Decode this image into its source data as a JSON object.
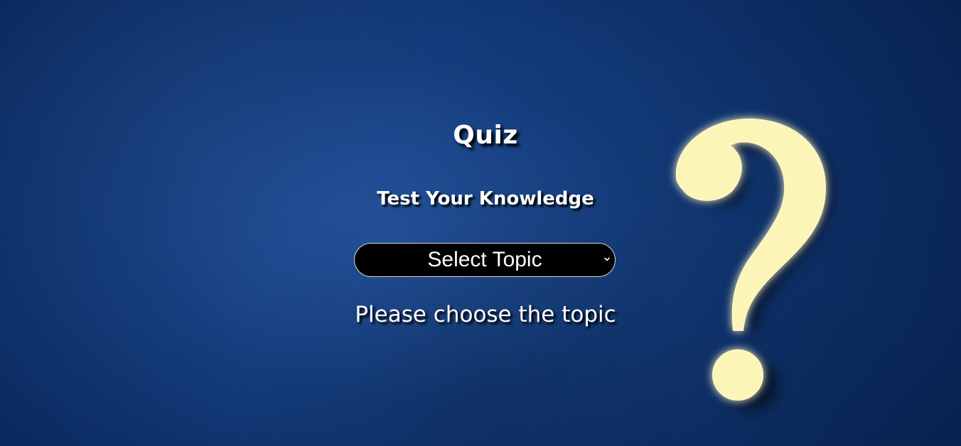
{
  "page": {
    "title": "Quiz",
    "subtitle": "Test Your Knowledge",
    "hint": "Please choose the topic"
  },
  "topic_select": {
    "selected_label": "Select Topic",
    "icon": "chevron-down-icon"
  },
  "decoration": {
    "icon": "question-mark-icon",
    "color": "#fbf5b8"
  },
  "colors": {
    "background": "#123a7a",
    "select_bg": "#000000",
    "text": "#ffffff"
  }
}
